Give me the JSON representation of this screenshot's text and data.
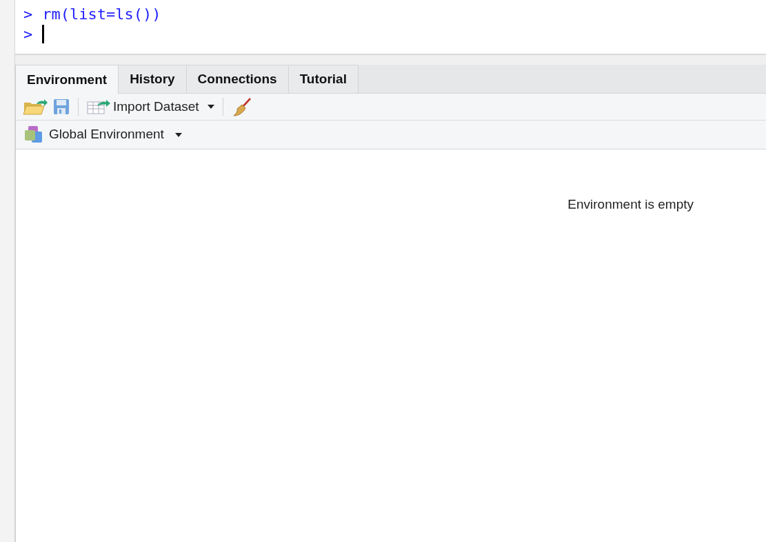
{
  "console": {
    "lines": [
      {
        "prompt": ">",
        "command": "rm(list=ls())",
        "cursor": false
      },
      {
        "prompt": ">",
        "cursor": true
      }
    ]
  },
  "tabs": [
    {
      "label": "Environment",
      "selected": true
    },
    {
      "label": "History",
      "selected": false
    },
    {
      "label": "Connections",
      "selected": false
    },
    {
      "label": "Tutorial",
      "selected": false
    }
  ],
  "toolbar": [
    {
      "kind": "open"
    },
    {
      "kind": "save"
    },
    {
      "kind": "separator"
    },
    {
      "kind": "import",
      "label": "Import Dataset"
    },
    {
      "kind": "separator"
    },
    {
      "kind": "clear"
    }
  ],
  "environment_selector": {
    "label": "Global Environment"
  },
  "empty_message": "Environment is empty"
}
